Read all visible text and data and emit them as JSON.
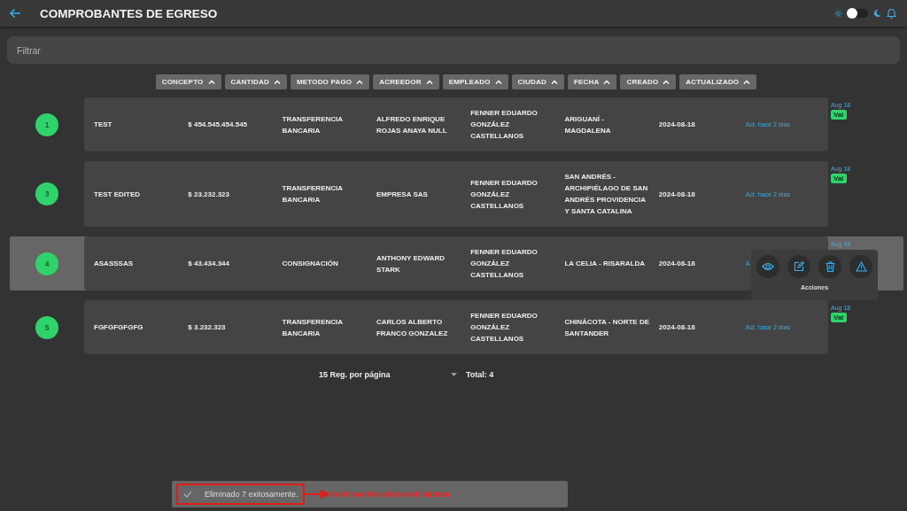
{
  "header": {
    "title": "COMPROBANTES DE EGRESO",
    "theme_toggle": {
      "on": false
    }
  },
  "filter": {
    "placeholder": "Filtrar"
  },
  "sort_columns": [
    {
      "label": "CONCEPTO"
    },
    {
      "label": "CANTIDAD"
    },
    {
      "label": "METODO PAGO"
    },
    {
      "label": "ACREEDOR"
    },
    {
      "label": "EMPLEADO"
    },
    {
      "label": "CIUDAD"
    },
    {
      "label": "FECHA"
    },
    {
      "label": "CREADO"
    },
    {
      "label": "ACTUALIZADO"
    }
  ],
  "rows": [
    {
      "number": "1",
      "selected": false,
      "concepto": "TEST",
      "cantidad": "$ 454.545.454.545",
      "metodo_pago": "TRANSFERENCIA BANCARIA",
      "acreedor": "ALFREDO ENRIQUE ROJAS ANAYA NULL",
      "empleado": "FENNER EDUARDO GONZÁLEZ CASTELLANOS",
      "ciudad": "ARIGUANÍ - MAGDALENA",
      "fecha": "2024-08-18",
      "actualizado": "Act. hace 2 días",
      "creado": "Aug 18",
      "badge": "Val"
    },
    {
      "number": "3",
      "selected": false,
      "concepto": "TEST EDITED",
      "cantidad": "$ 23.232.323",
      "metodo_pago": "TRANSFERENCIA BANCARIA",
      "acreedor": "EMPRESA SAS",
      "empleado": "FENNER EDUARDO GONZÁLEZ CASTELLANOS",
      "ciudad": "SAN ANDRÉS - ARCHIPIÉLAGO DE SAN ANDRÉS PROVIDENCIA Y SANTA CATALINA",
      "fecha": "2024-08-18",
      "actualizado": "Act. hace 2 días",
      "creado": "Aug 18",
      "badge": "Val"
    },
    {
      "number": "4",
      "selected": true,
      "concepto": "ASASSSAS",
      "cantidad": "$ 43.434.344",
      "metodo_pago": "CONSIGNACIÓN",
      "acreedor": "ANTHONY EDWARD STARK",
      "empleado": "FENNER EDUARDO GONZÁLEZ CASTELLANOS",
      "ciudad": "LA CELIA - RISARALDA",
      "fecha": "2024-08-18",
      "actualizado": "A",
      "creado": "Aug 18",
      "actions_label": "Acciones"
    },
    {
      "number": "5",
      "selected": false,
      "concepto": "FGFGFGFGFG",
      "cantidad": "$ 3.232.323",
      "metodo_pago": "TRANSFERENCIA BANCARIA",
      "acreedor": "CARLOS ALBERTO FRANCO GONZALEZ",
      "empleado": "FENNER EDUARDO GONZÁLEZ CASTELLANOS",
      "ciudad": "CHINÁCOTA - NORTE DE SANTANDER",
      "fecha": "2024-08-18",
      "actualizado": "Act. hace 2 días",
      "creado": "Aug 18",
      "badge": "Val"
    }
  ],
  "pagination": {
    "per_page": "15 Reg. por página",
    "total": "Total: 4"
  },
  "snackbar": {
    "message": "Eliminado 7 exitosamente.",
    "annotation": "Confirmación exitosa del sistema"
  }
}
